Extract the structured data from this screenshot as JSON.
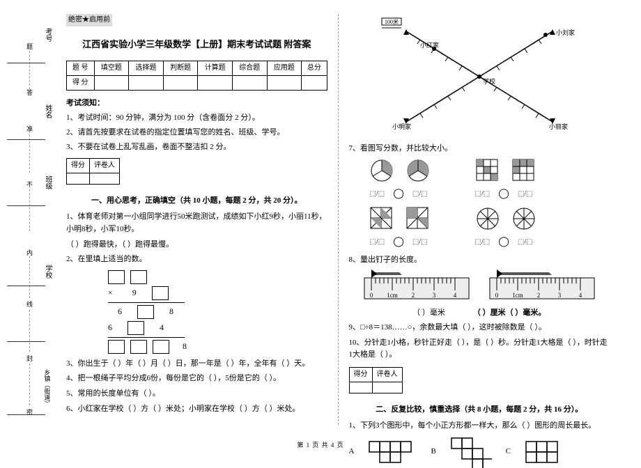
{
  "margin": {
    "xianhao": "考号",
    "da": "答",
    "ti": "题",
    "xingming": "姓名",
    "zhun": "准",
    "banji": "班级",
    "bu": "不",
    "nei": "内",
    "xuexiao": "学校",
    "xian": "线",
    "feng": "封",
    "xiangzhen": "乡镇（街道）",
    "mi": "密"
  },
  "secret": "绝密★启用前",
  "title": "江西省实验小学三年级数学【上册】期末考试试题 附答案",
  "scoretable": {
    "r1": [
      "题  号",
      "填空题",
      "选择题",
      "判断题",
      "计算题",
      "综合题",
      "应用题",
      "总分"
    ],
    "r2": [
      "得  分",
      "",
      "",
      "",
      "",
      "",
      "",
      ""
    ]
  },
  "notice_h": "考试须知：",
  "notices": [
    "1、考试时间：90 分钟，满分为 100 分（含卷面分 2 分）。",
    "2、请首先按要求在试卷的指定位置填写您的姓名、班级、学号。",
    "3、不要在试卷上乱写乱画，卷面不整洁扣 2 分。"
  ],
  "scorer": {
    "c1": "得分",
    "c2": "评卷人"
  },
  "sec1_h": "一、用心思考，正确填空（共 10 小题，每题 2 分，共 20 分）。",
  "q1a": "1、体育老师对第一小组同学进行50米跑测试，成绩如下小红9秒，小丽11秒，小明8秒，小军10秒。",
  "q1b": "（    ）跑得最快，（    ）跑得最慢。",
  "q2": "2、在里填上适当的数。",
  "mult": {
    "times": "×",
    "nine": "9",
    "six1": "6",
    "eight1": "8",
    "six2": "6",
    "four": "4"
  },
  "q3": "3、你出生于（    ）年（    ）月（    ）日，那一年是（    ）年，全年有（    ）天。",
  "q4": "4、把一根绳子平均分成6份，每份是它的（    ），5份是它的（    ）。",
  "q5": "5、常用的长度单位有（    ）。",
  "q6": "6、小红家在学校（    ）方（    ）米处；小明家在学校（    ）方（    ）米处。",
  "q7": "7、看图写分数，并比较大小。",
  "q8": "8、量出钉子的长度。",
  "ruler_mm": "（    ）毫米",
  "ruler_cm_mm": "（    ）厘米（    ）毫米。",
  "q9": "9、□÷8＝138……○，余数最大填（    ），这时被除数是（    ）。",
  "q10": "10、分针走1小格，秒针正好走（    ），是（    ）秒。分针走1大格是（    ），时针走1大格是（    ）。",
  "sec2_h": "二、反复比较，慎重选择（共 8 小题，每题 2 分，共 16 分）。",
  "q2_1": "1、下列3个图形中，每个小正方形都一样大，那么（    ）图形的周长最长。",
  "opt_a": "A",
  "opt_b": "B",
  "opt_c": "C",
  "map": {
    "scale": "100米",
    "liu": "小刘家",
    "hong": "小红家",
    "school": "学校",
    "ming": "小明家",
    "li": "小丽家"
  },
  "circle_sym": "◯",
  "footer": "第 1 页 共 4 页"
}
